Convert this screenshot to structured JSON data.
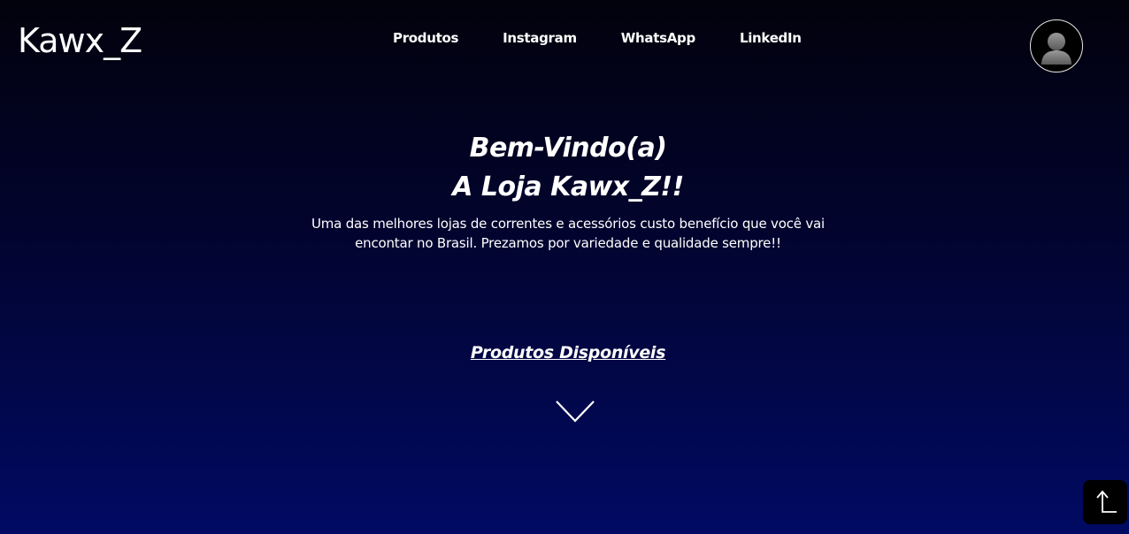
{
  "header": {
    "logo": "Kawx_Z",
    "nav": [
      {
        "label": "Produtos"
      },
      {
        "label": "Instagram"
      },
      {
        "label": "WhatsApp"
      },
      {
        "label": "LinkedIn"
      }
    ]
  },
  "hero": {
    "title_line1": "Bem-Vindo(a)",
    "title_line2": "A Loja Kawx_Z!!",
    "description_line1": "Uma das melhores lojas de correntes e acessórios custo benefício que você vai",
    "description_line2": "encontar no Brasil. Prezamos por variedade e qualidade sempre!!"
  },
  "products_link": "Produtos Disponíveis",
  "icons": {
    "avatar": "user-avatar-icon",
    "scroll_down": "chevron-down-icon",
    "back_to_top": "arrow-up-icon"
  },
  "colors": {
    "background_top": "#02020c",
    "background_bottom": "#010a63",
    "text": "#ffffff"
  }
}
